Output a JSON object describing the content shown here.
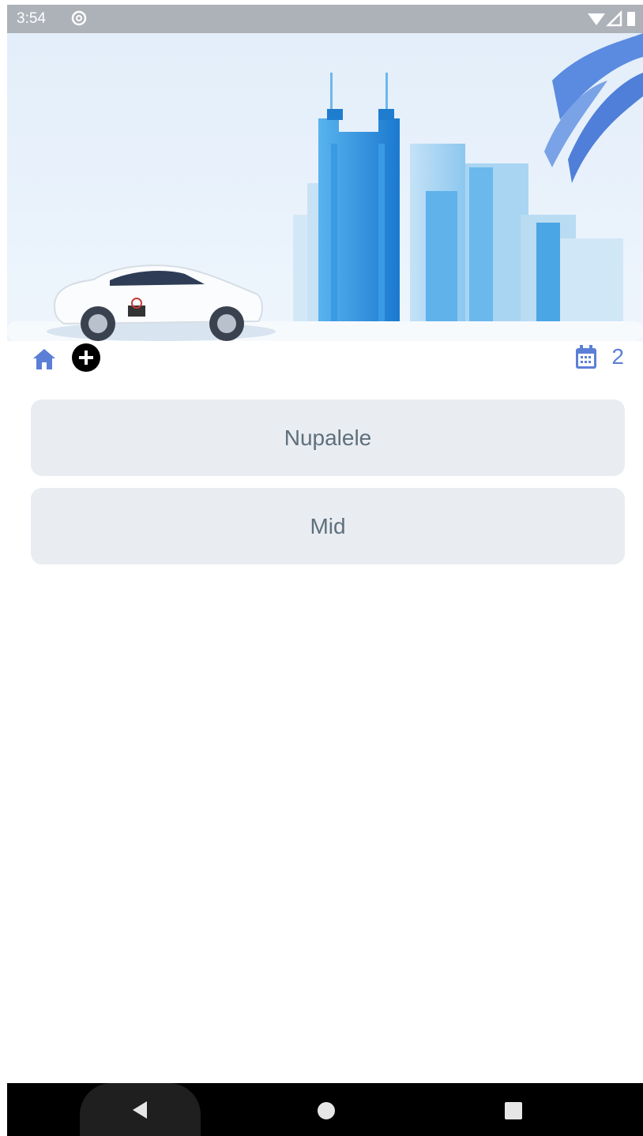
{
  "status_bar": {
    "time": "3:54",
    "left_icons": [
      "signal-off-icon",
      "circle-at-icon"
    ],
    "right_icons": [
      "wifi-icon",
      "cell-signal-icon",
      "battery-icon"
    ]
  },
  "banner": {
    "image": "city-car-banner",
    "colors": {
      "sky": "#e4f0fb",
      "building": "#2f8fde"
    }
  },
  "toolbar": {
    "home_icon": "home-icon",
    "add_icon": "add-circle-icon",
    "calendar_icon": "calendar-icon",
    "count": "2",
    "accent": "#5b7fd6"
  },
  "list": {
    "items": [
      {
        "label": "Nupalele"
      },
      {
        "label": "Mid"
      }
    ]
  },
  "nav_bar": {
    "back": "back-triangle-icon",
    "home": "home-circle-icon",
    "recents": "recents-square-icon"
  }
}
